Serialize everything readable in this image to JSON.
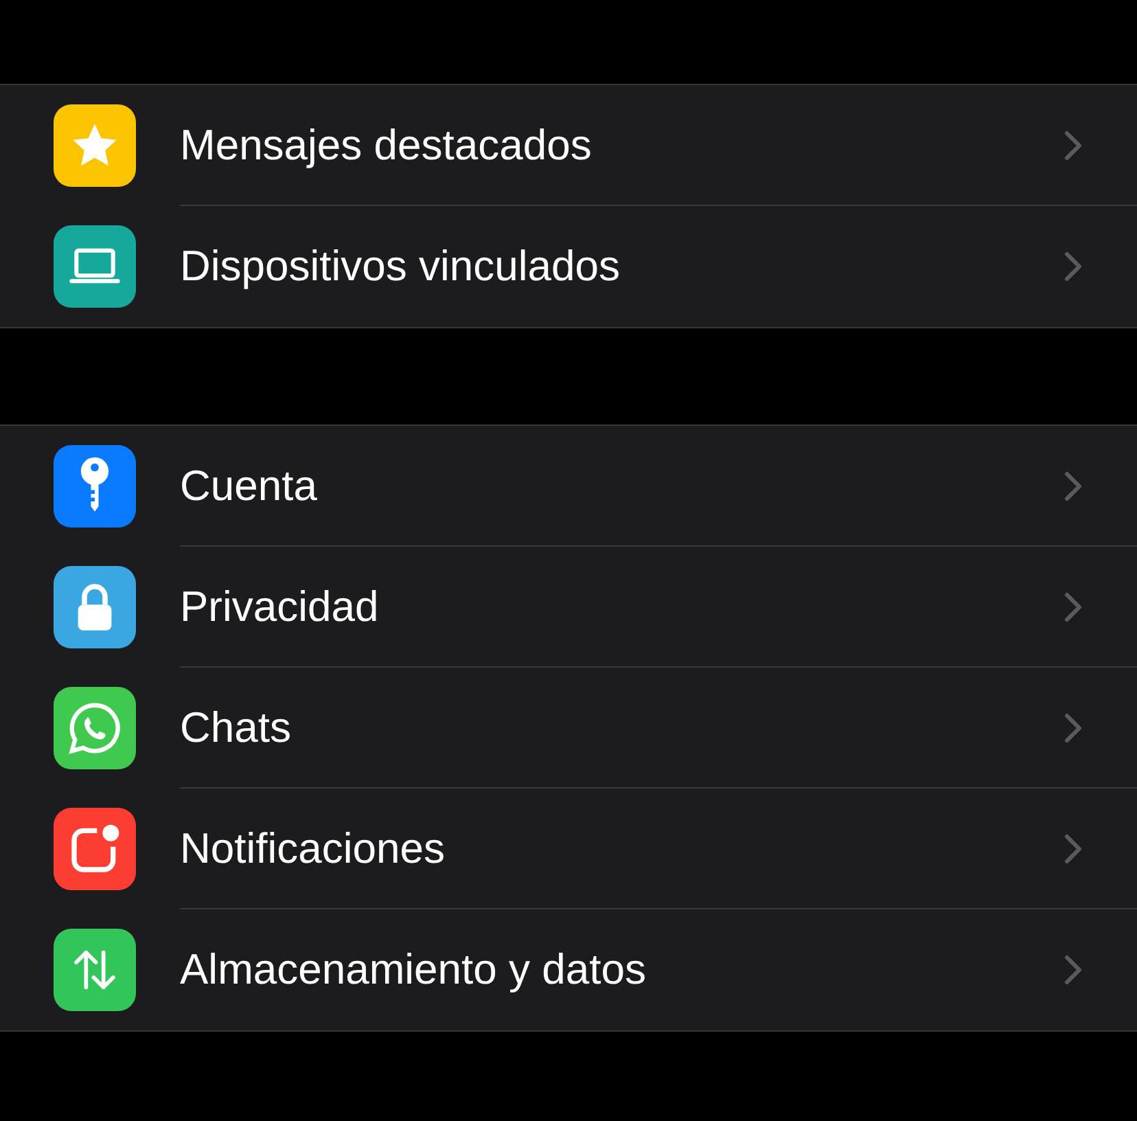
{
  "groups": [
    {
      "items": [
        {
          "kind": "star",
          "label": "Mensajes destacados",
          "color": "#fcc400"
        },
        {
          "kind": "laptop",
          "label": "Dispositivos vinculados",
          "color": "#17a89c"
        }
      ]
    },
    {
      "items": [
        {
          "kind": "key",
          "label": "Cuenta",
          "color": "#0a7bff"
        },
        {
          "kind": "lock",
          "label": "Privacidad",
          "color": "#3ba7e0"
        },
        {
          "kind": "chat",
          "label": "Chats",
          "color": "#40c94f"
        },
        {
          "kind": "bell",
          "label": "Notificaciones",
          "color": "#fc3d32"
        },
        {
          "kind": "arrows",
          "label": "Almacenamiento y datos",
          "color": "#32c55a"
        }
      ]
    }
  ]
}
